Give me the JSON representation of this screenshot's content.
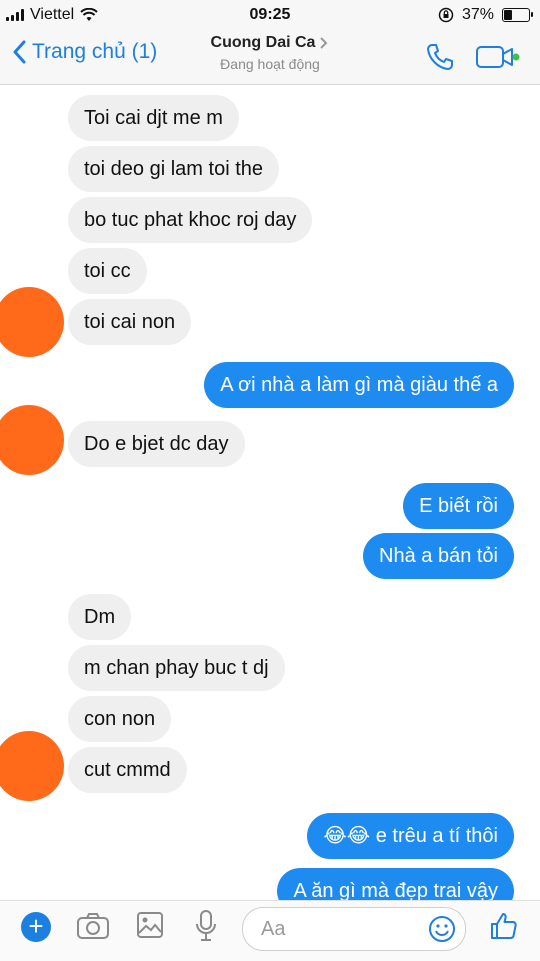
{
  "status_bar": {
    "carrier": "Viettel",
    "time": "09:25",
    "battery": "37%",
    "battery_level": 0.37
  },
  "header": {
    "back_label": "Trang chủ (1)",
    "contact_name": "Cuong Dai Ca",
    "contact_status": "Đang hoạt động",
    "accent": "#1d7fe0"
  },
  "messages": [
    {
      "from": "them",
      "text": "Toi cai djt me m"
    },
    {
      "from": "them",
      "text": "toi deo gi lam toi the"
    },
    {
      "from": "them",
      "text": "bo tuc phat khoc roj day"
    },
    {
      "from": "them",
      "text": "toi cc"
    },
    {
      "from": "them",
      "text": "toi cai non"
    },
    {
      "from": "me",
      "text": "A ơi nhà a làm gì mà giàu thế a"
    },
    {
      "from": "them",
      "text": "Do e bjet dc day"
    },
    {
      "from": "me",
      "text": "E biết rồi"
    },
    {
      "from": "me",
      "text": "Nhà a bán tỏi"
    },
    {
      "from": "them",
      "text": "Dm"
    },
    {
      "from": "them",
      "text": "m chan phay buc t dj"
    },
    {
      "from": "them",
      "text": "con non"
    },
    {
      "from": "them",
      "text": "cut cmmd"
    },
    {
      "from": "me",
      "text": "e trêu a tí thôi",
      "emoji": "😂😂"
    },
    {
      "from": "me",
      "text": "A ăn gì mà đẹp trai vậy"
    }
  ],
  "composer": {
    "placeholder": "Aa"
  },
  "colors": {
    "incoming_bubble": "#efefef",
    "outgoing_bubble": "#1d8bf0",
    "avatar_blur": "#ff6a1a"
  }
}
